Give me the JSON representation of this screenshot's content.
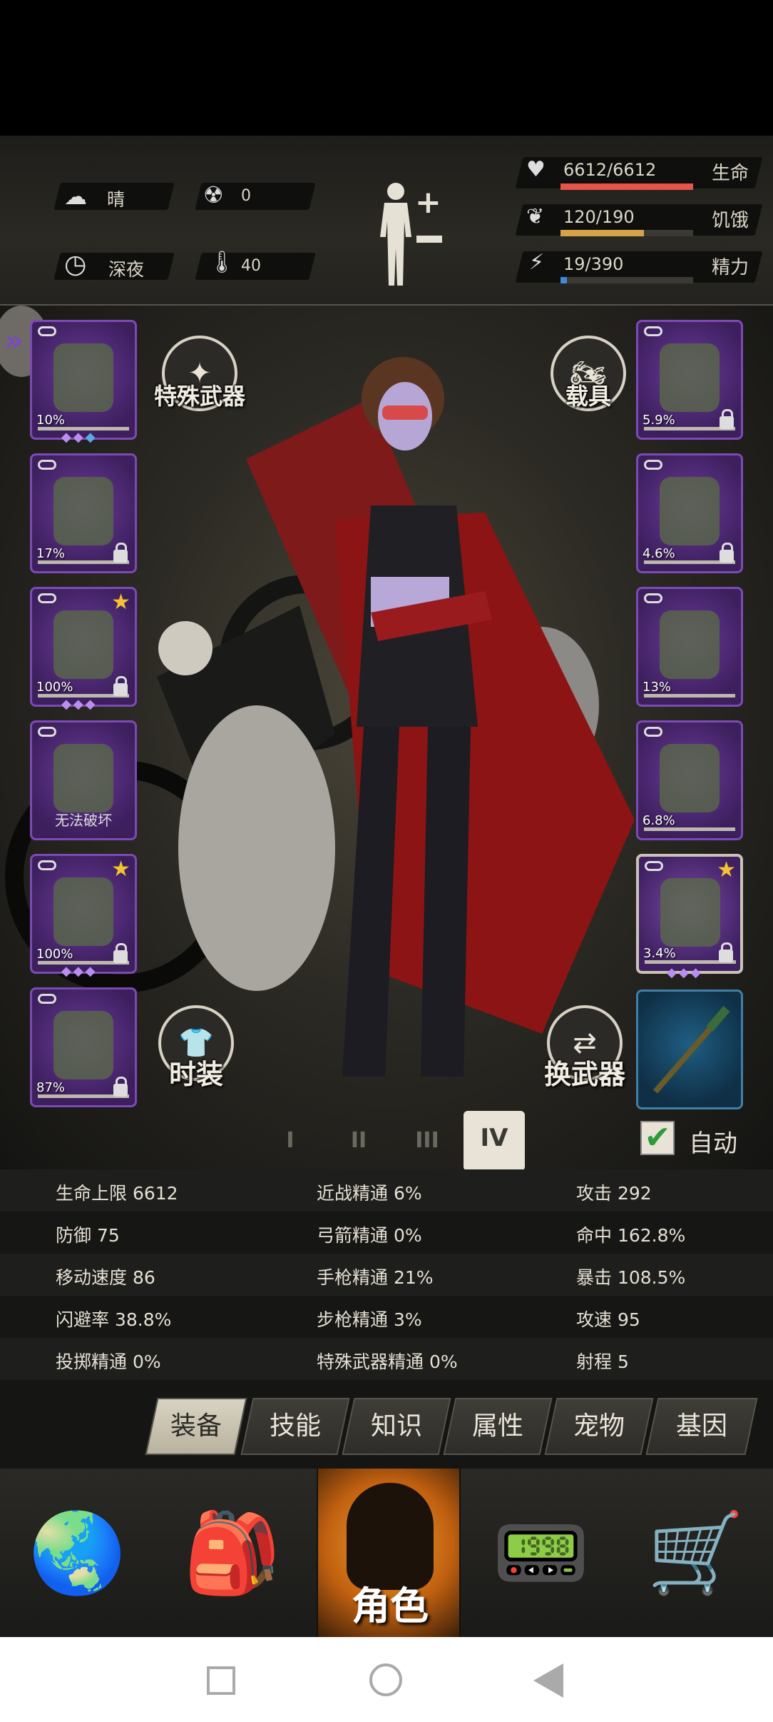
{
  "status": {
    "weather_label": "晴",
    "radiation_value": "0",
    "time_label": "深夜",
    "temperature_value": "40",
    "hp": {
      "text": "6612/6612",
      "label": "生命",
      "fraction": 1.0,
      "color": "#e8534a"
    },
    "hunger": {
      "text": "120/190",
      "label": "饥饿",
      "fraction": 0.63,
      "color": "#d8a24a"
    },
    "energy": {
      "text": "19/390",
      "label": "精力",
      "fraction": 0.05,
      "color": "#3b8bd8"
    }
  },
  "equipment_left": [
    {
      "name": "helmet",
      "pct": "10%",
      "locked": false,
      "star": false
    },
    {
      "name": "vest",
      "pct": "17%",
      "locked": true,
      "star": false
    },
    {
      "name": "jacket",
      "pct": "100%",
      "locked": true,
      "star": true
    },
    {
      "name": "backpack",
      "text": "无法破坏",
      "locked": false,
      "star": false
    },
    {
      "name": "pants",
      "pct": "100%",
      "locked": true,
      "star": true
    },
    {
      "name": "boots",
      "pct": "87%",
      "locked": true,
      "star": false
    }
  ],
  "equipment_right": [
    {
      "name": "goggles",
      "pct": "5.9%",
      "locked": true,
      "star": false
    },
    {
      "name": "gas-mask",
      "pct": "4.6%",
      "locked": true,
      "star": false
    },
    {
      "name": "armor",
      "pct": "13%",
      "locked": false,
      "star": false
    },
    {
      "name": "shield",
      "pct": "6.8%",
      "locked": false,
      "star": false
    },
    {
      "name": "pistol",
      "pct": "3.4%",
      "locked": true,
      "star": true
    }
  ],
  "buttons": {
    "special_weapon": "特殊武器",
    "vehicle": "载具",
    "fashion": "时装",
    "swap_weapon": "换武器",
    "auto": "自动"
  },
  "outfits": [
    "I",
    "II",
    "III",
    "IV"
  ],
  "stats": [
    [
      "生命上限 6612",
      "近战精通 6%",
      "攻击 292"
    ],
    [
      "防御 75",
      "弓箭精通 0%",
      "命中 162.8%"
    ],
    [
      "移动速度 86",
      "手枪精通 21%",
      "暴击 108.5%"
    ],
    [
      "闪避率 38.8%",
      "步枪精通 3%",
      "攻速 95"
    ],
    [
      "投掷精通 0%",
      "特殊武器精通 0%",
      "射程 5"
    ]
  ],
  "tabs": [
    "装备",
    "技能",
    "知识",
    "属性",
    "宠物",
    "基因"
  ],
  "nav": {
    "character_label": "角色"
  }
}
